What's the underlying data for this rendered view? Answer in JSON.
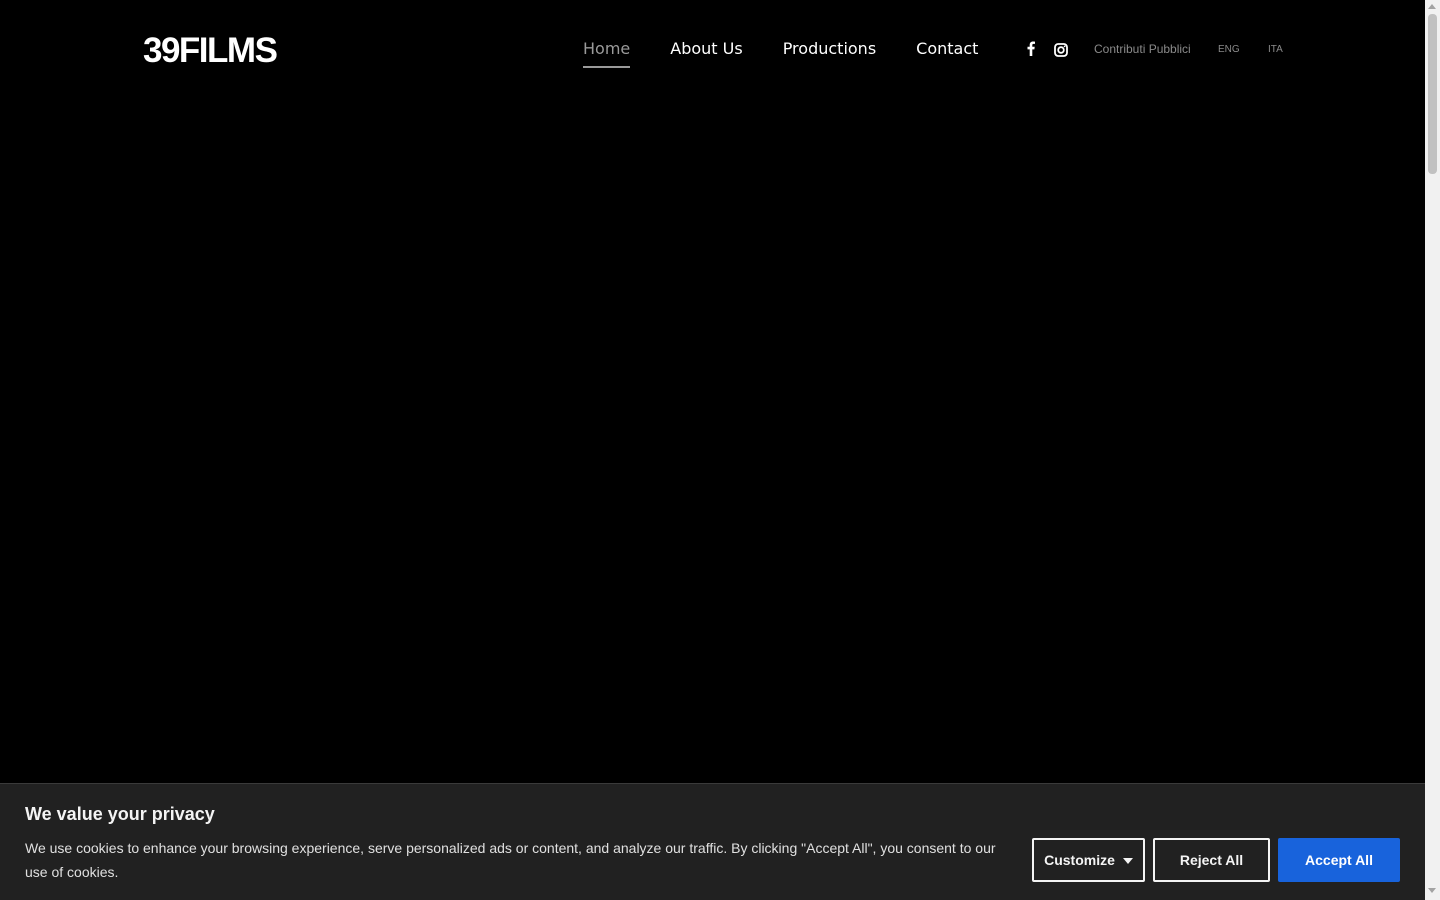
{
  "header": {
    "logo": "39FILMS",
    "nav": [
      {
        "label": "Home",
        "active": true
      },
      {
        "label": "About Us",
        "active": false
      },
      {
        "label": "Productions",
        "active": false
      },
      {
        "label": "Contact",
        "active": false
      }
    ],
    "social_icons": [
      "facebook-icon",
      "instagram-icon"
    ],
    "utility_links": {
      "contributi": "Contributi Pubblici",
      "eng": "ENG",
      "ita": "ITA"
    }
  },
  "cookie_banner": {
    "title": "We value your privacy",
    "text": "We use cookies to enhance your browsing experience, serve personalized ads or content, and analyze our traffic. By clicking \"Accept All\", you consent to our use of cookies.",
    "customize_label": "Customize",
    "reject_label": "Reject All",
    "accept_label": "Accept All"
  },
  "colors": {
    "background": "#000000",
    "nav_active": "#9a9a9a",
    "banner_background": "#212121",
    "accept_button": "#1863dc"
  }
}
